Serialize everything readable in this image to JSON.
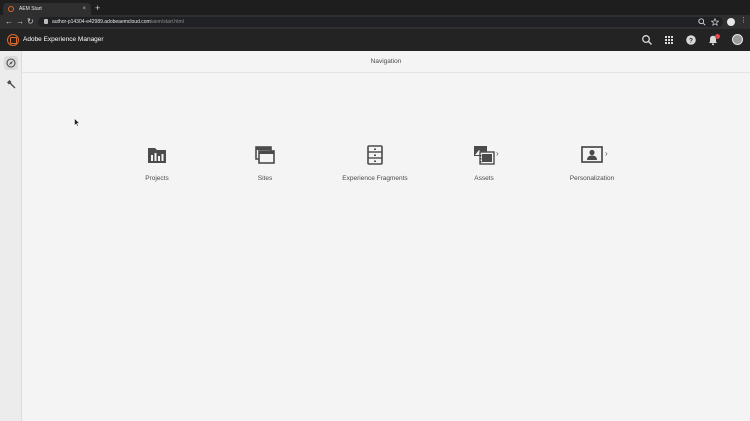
{
  "browser": {
    "tab_title": "AEM Start",
    "tab_close": "×",
    "new_tab": "+",
    "back": "←",
    "forward": "→",
    "reload": "↻",
    "url_host": "author-p14304-e42989.adobeaemcloud.com",
    "url_path": "/aem/start.html",
    "kebab": "⋮"
  },
  "shell": {
    "app_title": "Adobe Experience Manager",
    "icons": [
      "search-icon",
      "apps-grid-icon",
      "help-icon",
      "bell-icon",
      "user-avatar"
    ],
    "accent_color": "#e06b2c",
    "notification_color": "#e34850"
  },
  "rail": {
    "items": [
      {
        "name": "navigation-icon",
        "active": true
      },
      {
        "name": "tools-icon",
        "active": false
      }
    ]
  },
  "page": {
    "title": "Navigation"
  },
  "tiles": [
    {
      "label": "Projects",
      "icon": "projects-icon",
      "has_chevron": false
    },
    {
      "label": "Sites",
      "icon": "sites-icon",
      "has_chevron": false
    },
    {
      "label": "Experience Fragments",
      "icon": "experience-fragments-icon",
      "has_chevron": false
    },
    {
      "label": "Assets",
      "icon": "assets-icon",
      "has_chevron": true
    },
    {
      "label": "Personalization",
      "icon": "personalization-icon",
      "has_chevron": true
    }
  ],
  "chevron": "›"
}
